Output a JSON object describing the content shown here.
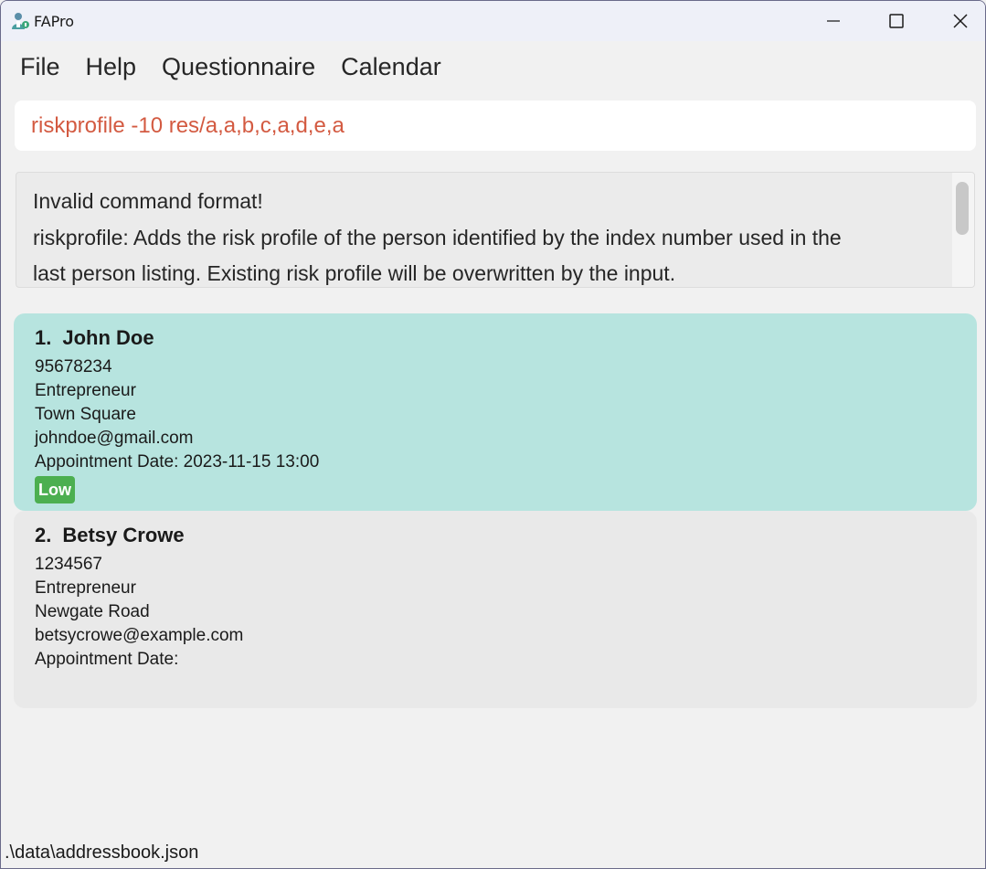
{
  "window": {
    "title": "FAPro",
    "icons": {
      "app": "app-logo-icon",
      "minimize": "minimize-icon",
      "maximize": "maximize-icon",
      "close": "close-icon"
    }
  },
  "menu": {
    "items": [
      "File",
      "Help",
      "Questionnaire",
      "Calendar"
    ]
  },
  "command": {
    "value": "riskprofile -10 res/a,a,b,c,a,d,e,a",
    "color": "#d35a41"
  },
  "result": {
    "lines": [
      "Invalid command format!",
      "riskprofile: Adds the risk profile of the person identified by the index number used in the",
      "last person listing. Existing risk profile will be overwritten by the input."
    ]
  },
  "persons": [
    {
      "index": "1.",
      "name": "John Doe",
      "phone": "95678234",
      "occupation": "Entrepreneur",
      "address": "Town Square",
      "email": "johndoe@gmail.com",
      "appointment": "Appointment Date: 2023-11-15 13:00",
      "risk": "Low",
      "selected": true,
      "card_color": "#b7e4df"
    },
    {
      "index": "2.",
      "name": "Betsy Crowe",
      "phone": "1234567",
      "occupation": "Entrepreneur",
      "address": "Newgate Road",
      "email": "betsycrowe@example.com",
      "appointment": "Appointment Date:",
      "selected": false,
      "card_color": "#e9e9e9"
    }
  ],
  "status": {
    "path": ".\\data\\addressbook.json"
  },
  "colors": {
    "background": "#f1f1f1",
    "titlebar": "#eef0f8",
    "risk_low": "#4caf50"
  }
}
